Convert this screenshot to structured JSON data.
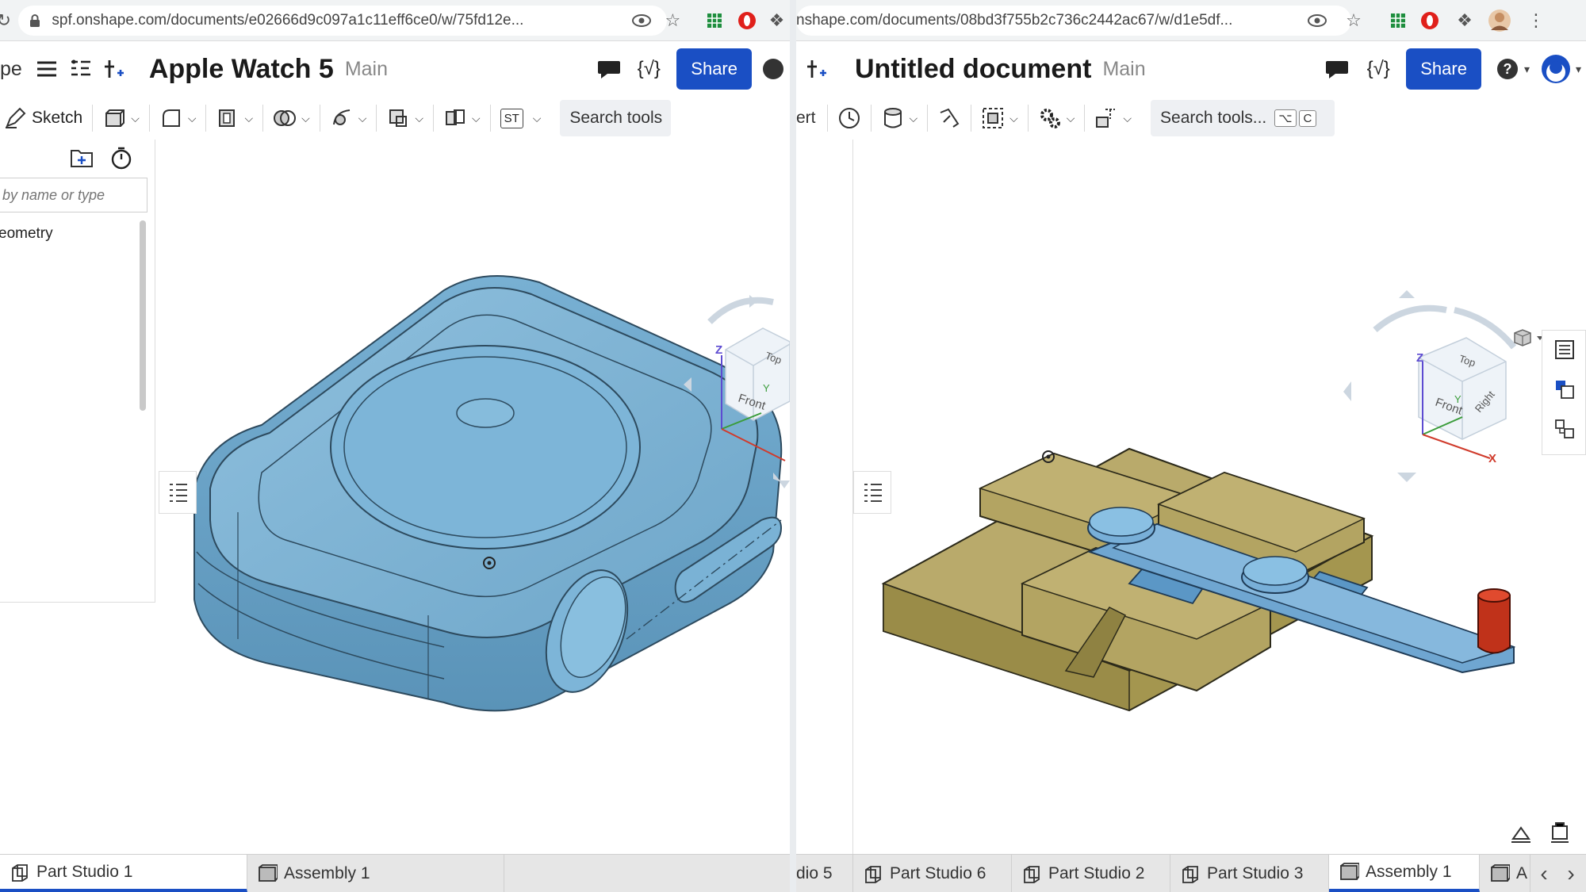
{
  "left": {
    "url": "spf.onshape.com/documents/e02666d9c097a1c11eff6ce0/w/75fd12e...",
    "nav_partial": "pe",
    "doc_title": "Apple Watch 5",
    "branch": "Main",
    "share_label": "Share",
    "toolbar": {
      "sketch_label": "Sketch",
      "st_label": "ST",
      "search_label": "Search tools"
    },
    "feature_panel": {
      "filter_placeholder": "by name or type",
      "tree_item": "eometry"
    },
    "viewcube": {
      "top": "Top",
      "front": "Front",
      "z": "Z",
      "y": "Y"
    },
    "tabs": [
      {
        "label": "Part Studio 1"
      },
      {
        "label": "Assembly 1"
      }
    ]
  },
  "right": {
    "url": "nshape.com/documents/08bd3f755b2c736c2442ac67/w/d1e5df...",
    "doc_title": "Untitled document",
    "branch": "Main",
    "share_label": "Share",
    "toolbar": {
      "partial_label": "ert",
      "search_label": "Search tools...",
      "shortcut_key1": "⌥",
      "shortcut_key2": "C"
    },
    "viewcube": {
      "top": "Top",
      "front": "Front",
      "right": "Right",
      "z": "Z",
      "x": "X",
      "y": "Y"
    },
    "tabs": [
      {
        "label": "dio 5"
      },
      {
        "label": "Part Studio 6"
      },
      {
        "label": "Part Studio 2"
      },
      {
        "label": "Part Studio 3"
      },
      {
        "label": "Assembly 1"
      },
      {
        "label": "A"
      }
    ]
  },
  "colors": {
    "share": "#1a4fc4",
    "part_blue": "#7fb3d5",
    "part_tan": "#b9a96a",
    "cylinder_red": "#c0321a"
  }
}
